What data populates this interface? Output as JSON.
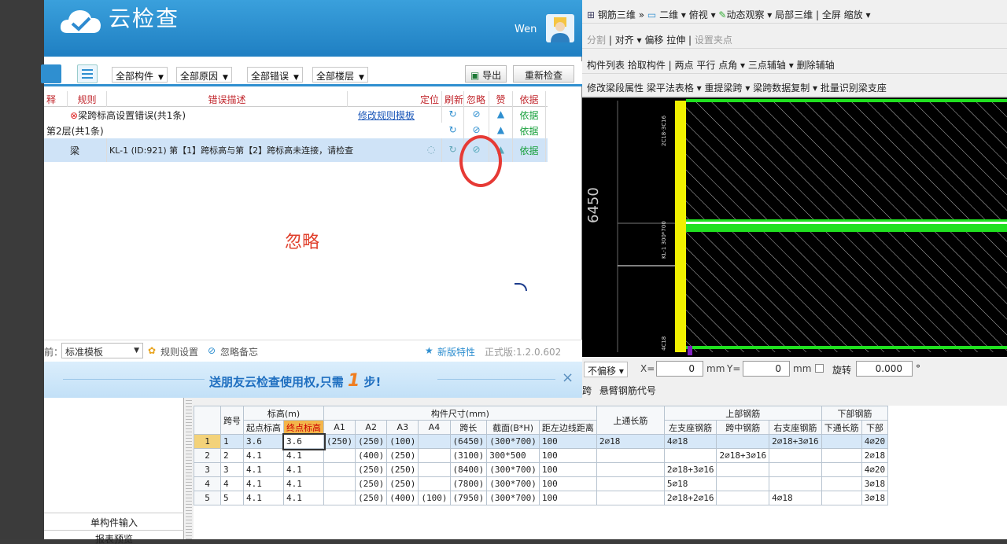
{
  "checker": {
    "title": "云检查",
    "user": "Wen",
    "toolbar": {
      "filters": [
        "全部构件",
        "全部原因",
        "全部错误",
        "全部楼层"
      ],
      "export_label": "导出",
      "recheck_label": "重新检查"
    },
    "table": {
      "headers": {
        "col0": "释",
        "rule": "规则",
        "desc": "错误描述",
        "locate": "定位",
        "refresh": "刷新",
        "ignore": "忽略",
        "like": "赞",
        "basis": "依据"
      },
      "group_row": {
        "label": "梁跨标高设置错误(共1条)",
        "link": "修改规则模板",
        "basis": "依据"
      },
      "floor_row": {
        "label": "第2层(共1条)",
        "basis": "依据"
      },
      "item_row": {
        "rule": "梁",
        "desc": "KL-1 (ID:921) 第【1】跨标高与第【2】跨标高未连接，请检查",
        "basis": "依据"
      }
    },
    "annotation": "忽略",
    "footer": {
      "template_prefix": "前：",
      "template_value": "标准模板",
      "rule_settings": "规则设置",
      "ignore_memo": "忽略备忘",
      "new_features": "新版特性",
      "version": "正式版:1.2.0.602"
    },
    "banner": {
      "text_a": "送朋友云检查使用权,只需",
      "number": "1",
      "text_b": "步!",
      "close": "×"
    }
  },
  "right": {
    "toolbar1": [
      "钢筋三维",
      "二维",
      "俯视",
      "动态观察",
      "局部三维",
      "全屏",
      "缩放"
    ],
    "toolbar2": [
      "分割",
      "对齐",
      "偏移",
      "拉伸",
      "设置夹点"
    ],
    "toolbar3": [
      "构件列表",
      "拾取构件",
      "两点",
      "平行",
      "点角",
      "三点辅轴",
      "删除辅轴"
    ],
    "toolbar4": [
      "修改梁段属性",
      "梁平法表格",
      "重提梁跨",
      "梁跨数据复制",
      "批量识别梁支座"
    ],
    "canvas": {
      "dim_label": "6450",
      "beam_label": "KL-1 300*700",
      "top_label": "2C18-3C16",
      "bottom_label": "4C18"
    },
    "coords": {
      "mode": "不偏移",
      "x_label": "X=",
      "x_value": "0",
      "unit": "mm",
      "y_label": "Y=",
      "y_value": "0",
      "rotate_label": "旋转",
      "rotate_value": "0.000",
      "deg": "°"
    },
    "tabs": [
      "跨",
      "悬臂钢筋代号"
    ]
  },
  "bottom": {
    "sidebar": {
      "item1": "单构件输入",
      "item2": "报表预览"
    },
    "grid": {
      "top_headers": {
        "span_no": "跨号",
        "elev": "标高(m)",
        "size": "构件尺寸(mm)",
        "top_long": "上通长筋",
        "top_rebar": "上部钢筋",
        "bottom_rebar": "下部钢筋"
      },
      "sub_headers": [
        "起点标高",
        "终点标高",
        "A1",
        "A2",
        "A3",
        "A4",
        "跨长",
        "截面(B*H)",
        "距左边线距离",
        "左支座钢筋",
        "跨中钢筋",
        "右支座钢筋",
        "下通长筋",
        "下部"
      ],
      "rows": [
        {
          "idx": "1",
          "span": "1",
          "start": "3.6",
          "end": "3.6",
          "a1": "(250)",
          "a2": "(250)",
          "a3": "(100)",
          "a4": "",
          "len": "(6450)",
          "sec": "(300*700)",
          "dist": "100",
          "toplong": "2⌀18",
          "left": "4⌀18",
          "mid": "",
          "right": "2⌀18+3⌀16",
          "botlong": "",
          "bot": "4⌀20"
        },
        {
          "idx": "2",
          "span": "2",
          "start": "4.1",
          "end": "4.1",
          "a1": "",
          "a2": "(400)",
          "a3": "(250)",
          "a4": "",
          "len": "(3100)",
          "sec": "300*500",
          "dist": "100",
          "toplong": "",
          "left": "",
          "mid": "2⌀18+3⌀16",
          "right": "",
          "botlong": "",
          "bot": "2⌀18"
        },
        {
          "idx": "3",
          "span": "3",
          "start": "4.1",
          "end": "4.1",
          "a1": "",
          "a2": "(250)",
          "a3": "(250)",
          "a4": "",
          "len": "(8400)",
          "sec": "(300*700)",
          "dist": "100",
          "toplong": "",
          "left": "2⌀18+3⌀16",
          "mid": "",
          "right": "",
          "botlong": "",
          "bot": "4⌀20"
        },
        {
          "idx": "4",
          "span": "4",
          "start": "4.1",
          "end": "4.1",
          "a1": "",
          "a2": "(250)",
          "a3": "(250)",
          "a4": "",
          "len": "(7800)",
          "sec": "(300*700)",
          "dist": "100",
          "toplong": "",
          "left": "5⌀18",
          "mid": "",
          "right": "",
          "botlong": "",
          "bot": "3⌀18"
        },
        {
          "idx": "5",
          "span": "5",
          "start": "4.1",
          "end": "4.1",
          "a1": "",
          "a2": "(250)",
          "a3": "(400)",
          "a4": "(100)",
          "len": "(7950)",
          "sec": "(300*700)",
          "dist": "100",
          "toplong": "",
          "left": "2⌀18+2⌀16",
          "mid": "",
          "right": "4⌀18",
          "botlong": "",
          "bot": "3⌀18"
        }
      ]
    }
  }
}
